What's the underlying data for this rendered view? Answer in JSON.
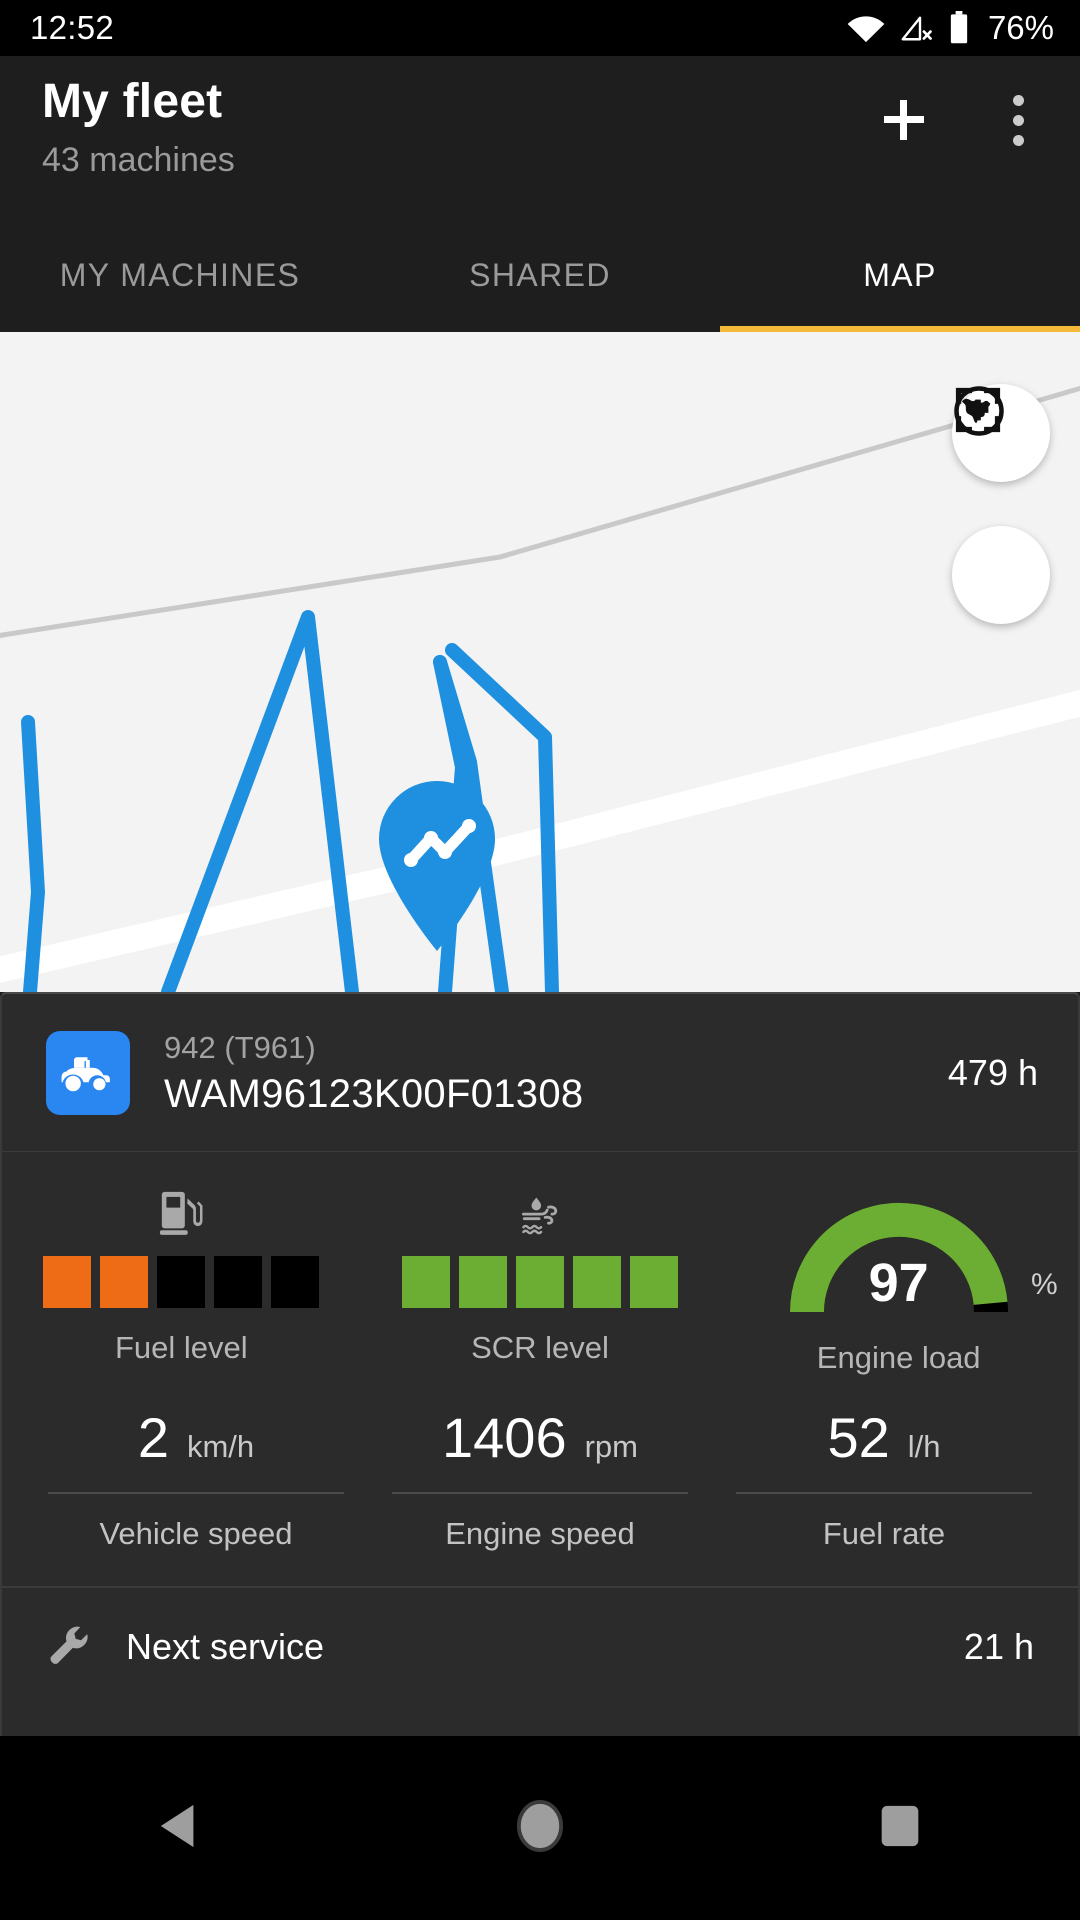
{
  "status_bar": {
    "time": "12:52",
    "battery_percent": "76%",
    "icons": [
      "wifi-icon",
      "cellular-no-signal-icon",
      "battery-icon"
    ]
  },
  "app_bar": {
    "title": "My fleet",
    "subtitle": "43 machines",
    "add_label": "+",
    "overflow_label": "⋮"
  },
  "tabs": [
    {
      "label": "MY MACHINES",
      "active": false
    },
    {
      "label": "SHARED",
      "active": false
    },
    {
      "label": "MAP",
      "active": true
    }
  ],
  "map": {
    "background_color": "#f3f3f3",
    "track_color": "#1f8fe0",
    "road_color": "#ffffff",
    "minor_road_color": "#c9c9c9",
    "marker": {
      "name": "machine-track-marker",
      "color": "#1f8fe0"
    },
    "controls": [
      {
        "name": "map-type-button",
        "icon": "globe-icon"
      },
      {
        "name": "center-map-button",
        "icon": "focus-crosshair-icon"
      }
    ]
  },
  "machine": {
    "model": "942 (T961)",
    "serial": "WAM96123K00F01308",
    "hours": "479 h",
    "icon": "tractor-icon"
  },
  "gauges": [
    {
      "name": "fuel-level",
      "label": "Fuel level",
      "icon": "fuel-pump-icon",
      "segments_total": 5,
      "segments_filled": 2,
      "fill_color": "#ef6c16",
      "empty_color": "#000000"
    },
    {
      "name": "scr-level",
      "label": "SCR level",
      "icon": "def-fluid-icon",
      "segments_total": 5,
      "segments_filled": 5,
      "fill_color": "#6cad33",
      "empty_color": "#000000"
    }
  ],
  "engine_load": {
    "label": "Engine load",
    "value": "97",
    "unit": "%",
    "percent": 97,
    "arc_color": "#6cad33",
    "track_color": "#000000"
  },
  "metrics": [
    {
      "name": "vehicle-speed",
      "value": "2",
      "unit": "km/h",
      "label": "Vehicle speed"
    },
    {
      "name": "engine-speed",
      "value": "1406",
      "unit": "rpm",
      "label": "Engine speed"
    },
    {
      "name": "fuel-rate",
      "value": "52",
      "unit": "l/h",
      "label": "Fuel rate"
    }
  ],
  "next_service": {
    "icon": "wrench-icon",
    "label": "Next service",
    "value": "21 h"
  },
  "nav_bar": [
    {
      "name": "nav-back-button",
      "icon": "back-triangle-icon"
    },
    {
      "name": "nav-home-button",
      "icon": "home-circle-icon"
    },
    {
      "name": "nav-recents-button",
      "icon": "recents-square-icon"
    }
  ]
}
